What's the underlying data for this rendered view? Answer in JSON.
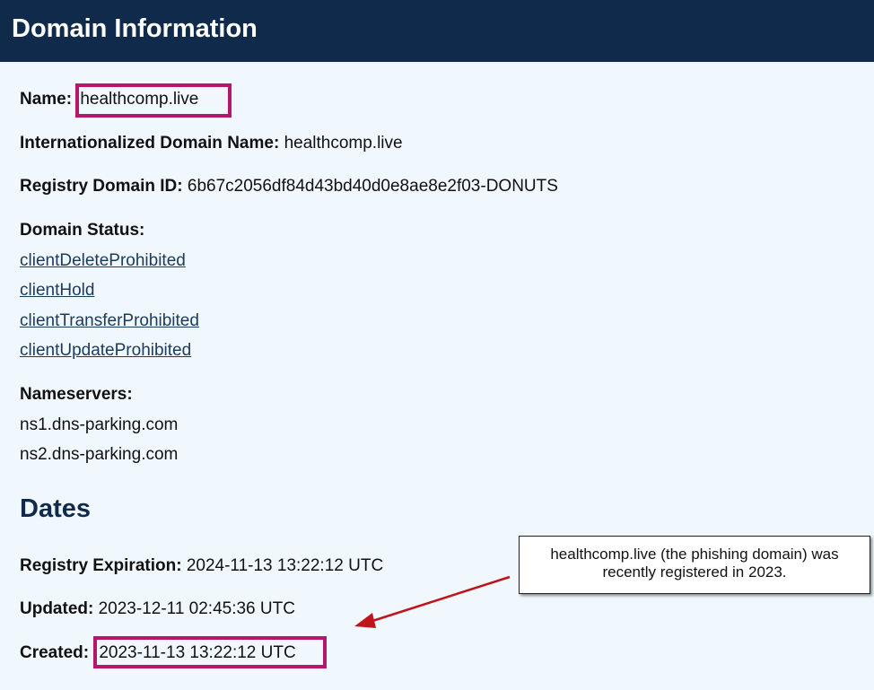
{
  "header": {
    "title": "Domain Information"
  },
  "domain": {
    "name_label": "Name:",
    "name_value": "healthcomp.live",
    "idn_label": "Internationalized Domain Name:",
    "idn_value": "healthcomp.live",
    "registry_id_label": "Registry Domain ID:",
    "registry_id_value": "6b67c2056df84d43bd40d0e8ae8e2f03-DONUTS",
    "status_label": "Domain Status:",
    "statuses": [
      "clientDeleteProhibited",
      "clientHold",
      "clientTransferProhibited",
      "clientUpdateProhibited"
    ],
    "nameservers_label": "Nameservers:",
    "nameservers": [
      "ns1.dns-parking.com",
      "ns2.dns-parking.com"
    ]
  },
  "dates": {
    "title": "Dates",
    "expiration_label": "Registry Expiration:",
    "expiration_value": "2024-11-13 13:22:12 UTC",
    "updated_label": "Updated:",
    "updated_value": "2023-12-11 02:45:36 UTC",
    "created_label": "Created:",
    "created_value": "2023-11-13 13:22:12 UTC"
  },
  "annotation": {
    "line1": "healthcomp.live (the phishing domain) was",
    "line2": "recently registered in 2023."
  },
  "colors": {
    "header_bg": "#0f2a4a",
    "page_bg": "#f0f8fd",
    "highlight": "#b5176e",
    "arrow": "#c0141c"
  }
}
